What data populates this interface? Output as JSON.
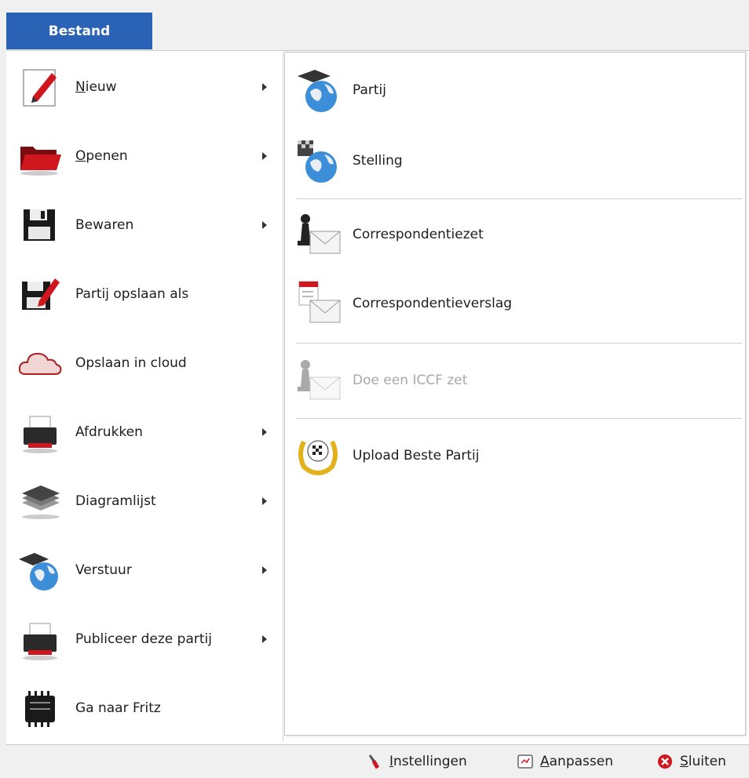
{
  "tab": {
    "label": "Bestand"
  },
  "menu": {
    "items": [
      {
        "label": "Nieuw",
        "submenu": true
      },
      {
        "label": "Openen",
        "submenu": true
      },
      {
        "label": "Bewaren",
        "submenu": true
      },
      {
        "label": "Partij opslaan als",
        "submenu": false
      },
      {
        "label": "Opslaan in cloud",
        "submenu": false
      },
      {
        "label": "Afdrukken",
        "submenu": true
      },
      {
        "label": "Diagramlijst",
        "submenu": true
      },
      {
        "label": "Verstuur",
        "submenu": true
      },
      {
        "label": "Publiceer deze partij",
        "submenu": true
      },
      {
        "label": "Ga naar Fritz",
        "submenu": false
      }
    ]
  },
  "submenu": {
    "items": [
      {
        "label": "Partij",
        "enabled": true
      },
      {
        "label": "Stelling",
        "enabled": true
      },
      {
        "label": "Correspondentiezet",
        "enabled": true
      },
      {
        "label": "Correspondentieverslag",
        "enabled": true
      },
      {
        "label": "Doe een ICCF zet",
        "enabled": false
      },
      {
        "label": "Upload Beste Partij",
        "enabled": true
      }
    ]
  },
  "footer": {
    "settings_label": "Instellingen",
    "customize_label": "Aanpassen",
    "close_label": "Sluiten"
  },
  "colors": {
    "tab_blue": "#2a62b5",
    "accent_red": "#d0161e",
    "disabled_text": "#a8a8a8"
  }
}
